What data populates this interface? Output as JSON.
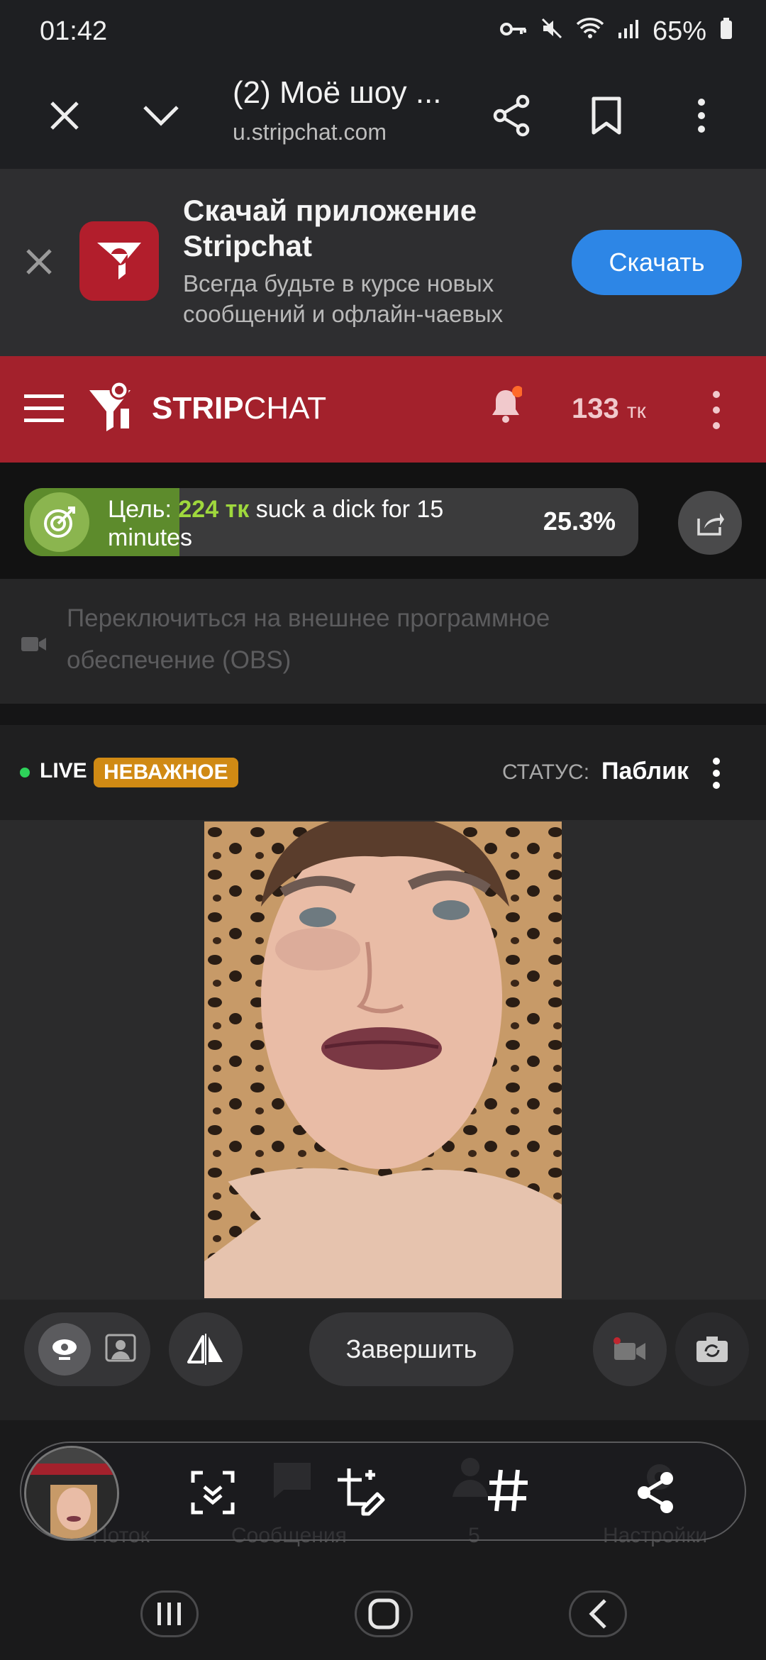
{
  "status_bar": {
    "time": "01:42",
    "battery": "65%"
  },
  "browser": {
    "tab_title": "(2) Моё шоу ...",
    "url": "u.stripchat.com"
  },
  "app_banner": {
    "title": "Скачай приложение Stripchat",
    "subtitle": "Всегда будьте в курсе новых сообщений и офлайн-чаевых",
    "download_label": "Скачать"
  },
  "site_header": {
    "logo_text_bold": "STRIP",
    "logo_text_light": "CHAT",
    "tokens_value": "133",
    "tokens_unit": "тк"
  },
  "goal": {
    "label": "Цель:",
    "amount": "224 тк",
    "text": "suck a dick for 15 minutes",
    "percent_label": "25.3%",
    "progress": 0.253
  },
  "obs": {
    "text": "Переключиться на внешнее программное обеспечение (OBS)"
  },
  "stream": {
    "live_label": "LIVE",
    "badge": "НЕВАЖНОЕ",
    "status_label": "СТАТУС:",
    "status_value": "Паблик"
  },
  "controls": {
    "finish_label": "Завершить"
  },
  "bottom_nav": {
    "items": [
      "Поток",
      "Сообщения",
      "5",
      "Настройки"
    ]
  },
  "colors": {
    "brand_red": "#a3212c",
    "download_blue": "#2d86e6",
    "goal_green": "#9fd83d",
    "badge_orange": "#d08a14",
    "live_green": "#2ed35a"
  }
}
